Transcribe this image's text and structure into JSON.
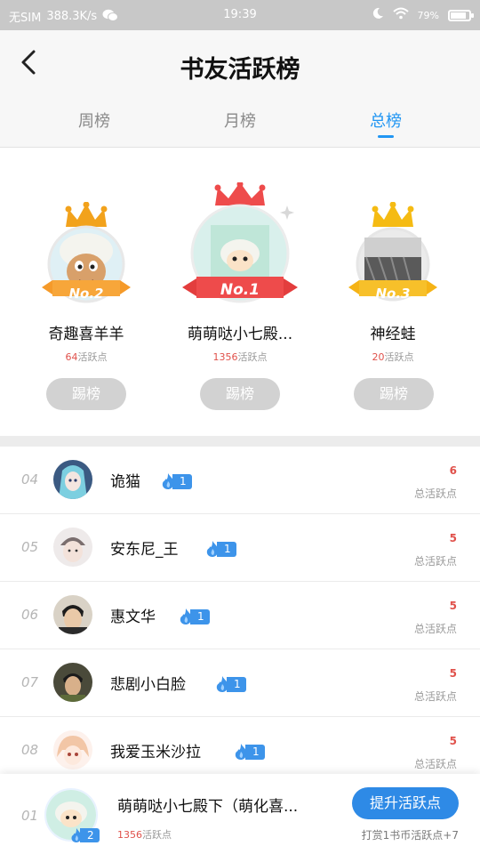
{
  "status_bar": {
    "carrier": "无SIM",
    "network_speed": "388.3K/s",
    "time": "19:39",
    "battery": "79%",
    "battery_level": 0.79
  },
  "header": {
    "title": "书友活跃榜"
  },
  "tabs": [
    {
      "label": "周榜",
      "active": false
    },
    {
      "label": "月榜",
      "active": false
    },
    {
      "label": "总榜",
      "active": true
    }
  ],
  "podium": [
    {
      "badge": "No.2",
      "name": "奇趣喜羊羊",
      "points": "64",
      "points_label": "活跃点",
      "button": "踢榜",
      "crown_color": "#f2a21c",
      "ribbon_color": "#f59a2a"
    },
    {
      "badge": "No.1",
      "name": "萌萌哒小七殿...",
      "points": "1356",
      "points_label": "活跃点",
      "button": "踢榜",
      "crown_color": "#ee4b4b",
      "ribbon_color": "#ee4b4b"
    },
    {
      "badge": "No.3",
      "name": "神经蛙",
      "points": "20",
      "points_label": "活跃点",
      "button": "踢榜",
      "crown_color": "#f5bb13",
      "ribbon_color": "#f5b316"
    }
  ],
  "list": [
    {
      "rank": "04",
      "name": "诡猫",
      "level": "1",
      "points": "6",
      "points_label": "总活跃点"
    },
    {
      "rank": "05",
      "name": "安东尼_王",
      "level": "1",
      "points": "5",
      "points_label": "总活跃点"
    },
    {
      "rank": "06",
      "name": "惠文华",
      "level": "1",
      "points": "5",
      "points_label": "总活跃点"
    },
    {
      "rank": "07",
      "name": "悲剧小白脸",
      "level": "1",
      "points": "5",
      "points_label": "总活跃点"
    },
    {
      "rank": "08",
      "name": "我爱玉米沙拉",
      "level": "1",
      "points": "5",
      "points_label": "总活跃点"
    }
  ],
  "me": {
    "rank": "01",
    "name": "萌萌哒小七殿下（萌化喜...",
    "level": "2",
    "points": "1356",
    "points_label": "活跃点",
    "boost_button": "提升活跃点",
    "reward_text": "打赏1书币活跃点+7"
  },
  "colors": {
    "accent": "#2196f3",
    "points_red": "#e0514b",
    "button_blue": "#2e8ae6"
  }
}
